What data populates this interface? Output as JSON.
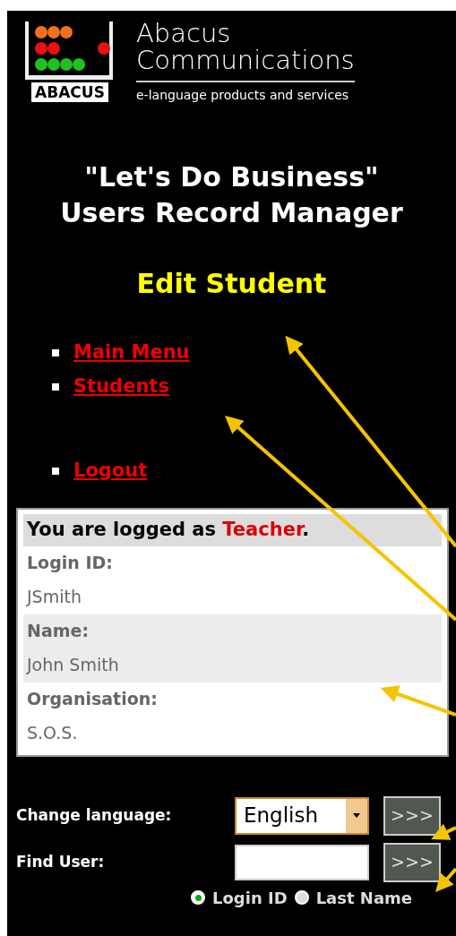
{
  "logo": {
    "wordmark": "ABACUS",
    "company_lines": [
      "Abacus",
      "Communications"
    ],
    "tagline": "e-language products and services"
  },
  "title_lines": [
    "\"Let's Do Business\"",
    "Users Record Manager"
  ],
  "page_heading": "Edit Student",
  "menu": [
    {
      "label": "Main Menu",
      "gap_before": false
    },
    {
      "label": "Students",
      "gap_before": false
    },
    {
      "label": "Logout",
      "gap_before": true
    }
  ],
  "user_info": {
    "logged_as_prefix": "You are logged as ",
    "role": "Teacher",
    "logged_as_suffix": ".",
    "fields": [
      {
        "label": "Login ID:",
        "value": "JSmith",
        "shaded": false
      },
      {
        "label": "Name:",
        "value": "John Smith",
        "shaded": true
      },
      {
        "label": "Organisation:",
        "value": "S.O.S.",
        "shaded": false
      }
    ]
  },
  "language": {
    "label": "Change language:",
    "value": "English",
    "button": ">>>"
  },
  "find_user": {
    "label": "Find User:",
    "button": ">>>",
    "options": [
      {
        "label": "Login ID",
        "selected": true
      },
      {
        "label": "Last Name",
        "selected": false
      }
    ]
  }
}
